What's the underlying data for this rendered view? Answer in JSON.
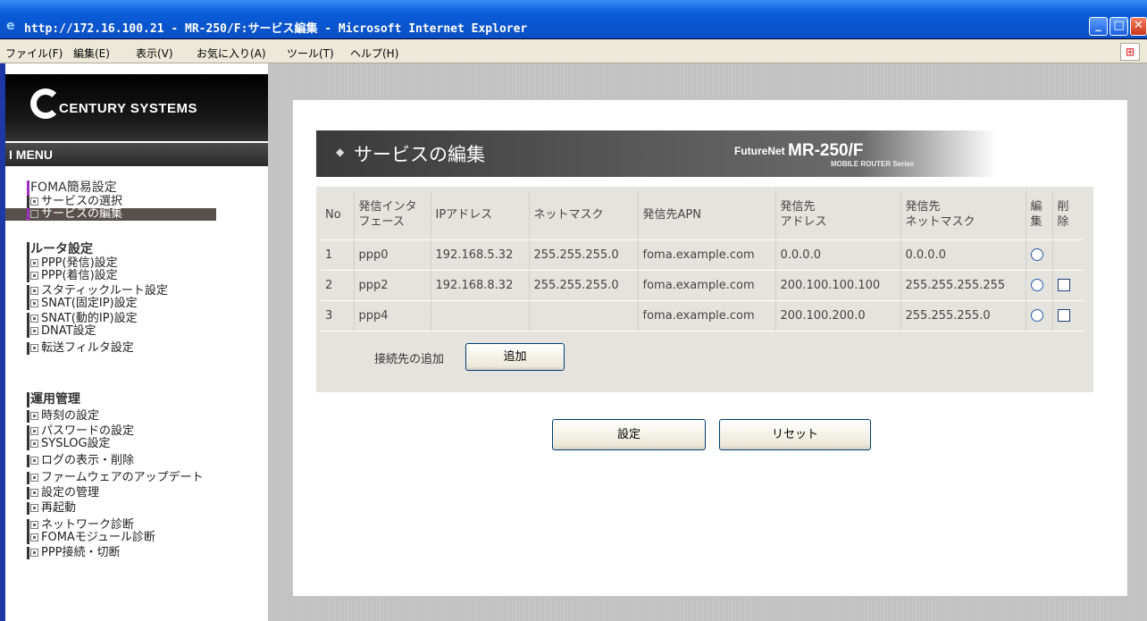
{
  "window": {
    "title": "http://172.16.100.21 - MR-250/F:サービス編集 - Microsoft Internet Explorer",
    "controls": [
      "_",
      "□",
      "✕"
    ]
  },
  "menubar": {
    "items": [
      "ファイル(F)",
      "編集(E)",
      "表示(V)",
      "お気に入り(A)",
      "ツール(T)",
      "ヘルプ(H)"
    ]
  },
  "sidebar": {
    "brand": "CENTURY SYSTEMS",
    "menu_header": "I MENU",
    "sections": [
      {
        "title": "FOMA簡易設定",
        "items": [
          "サービスの選択",
          "サービスの編集"
        ],
        "selected_index": 1
      },
      {
        "title": "ルータ設定",
        "items": [
          "PPP(発信)設定",
          "PPP(着信)設定",
          "スタティックルート設定",
          "SNAT(固定IP)設定",
          "SNAT(動的IP)設定",
          "DNAT設定",
          "転送フィルタ設定"
        ]
      },
      {
        "title": "運用管理",
        "items": [
          "時刻の設定",
          "パスワードの設定",
          "SYSLOG設定",
          "ログの表示・削除",
          "ファームウェアのアップデート",
          "設定の管理",
          "再起動",
          "ネットワーク診断",
          "FOMAモジュール診断",
          "PPP接続・切断"
        ]
      }
    ]
  },
  "banner": {
    "title": "サービスの編集",
    "product_prefix": "FutureNet",
    "product_model": "MR-250/F",
    "series": "MOBILE ROUTER Series"
  },
  "table": {
    "headers": [
      "No",
      "発信インタフェース",
      "IPアドレス",
      "ネットマスク",
      "発信先APN",
      "発信先アドレス",
      "発信先ネットマスク",
      "編集",
      "削除"
    ],
    "header_lines": [
      [
        "No"
      ],
      [
        "発信インタ",
        "フェース"
      ],
      [
        "IPアドレス"
      ],
      [
        "ネットマスク"
      ],
      [
        "発信先APN"
      ],
      [
        "発信先",
        "アドレス"
      ],
      [
        "発信先",
        "ネットマスク"
      ],
      [
        "編",
        "集"
      ],
      [
        "削",
        "除"
      ]
    ],
    "rows": [
      {
        "no": "1",
        "iface": "ppp0",
        "ip": "192.168.5.32",
        "mask": "255.255.255.0",
        "apn": "foma.example.com",
        "dest": "0.0.0.0",
        "dest_mask": "0.0.0.0",
        "has_delete": false
      },
      {
        "no": "2",
        "iface": "ppp2",
        "ip": "192.168.8.32",
        "mask": "255.255.255.0",
        "apn": "foma.example.com",
        "dest": "200.100.100.100",
        "dest_mask": "255.255.255.255",
        "has_delete": true
      },
      {
        "no": "3",
        "iface": "ppp4",
        "ip": "",
        "mask": "",
        "apn": "foma.example.com",
        "dest": "200.100.200.0",
        "dest_mask": "255.255.255.0",
        "has_delete": true
      }
    ],
    "add_label": "接続先の追加",
    "add_button": "追加"
  },
  "actions": {
    "submit": "設定",
    "reset": "リセット"
  },
  "colors": {
    "title_bar": "#0b5bd9",
    "window_border": "#1b3aa8",
    "selected_item": "#58504d",
    "accent_purple": "#a030c0",
    "content_bg": "#c3c3c3",
    "table_bg": "#e4e3de"
  }
}
